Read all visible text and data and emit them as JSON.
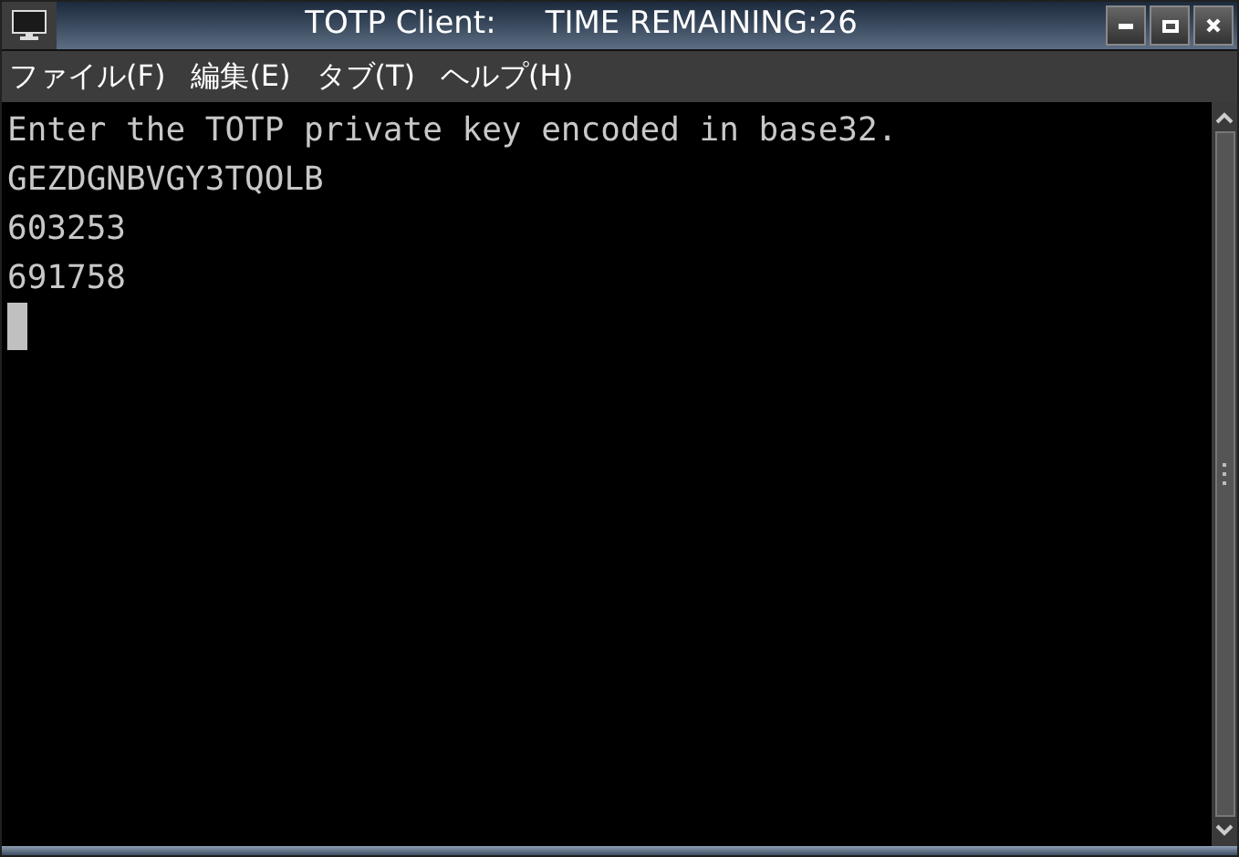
{
  "window": {
    "title": "TOTP Client:     TIME REMAINING:26"
  },
  "menu": [
    "ファイル(F)",
    "編集(E)",
    "タブ(T)",
    "ヘルプ(H)"
  ],
  "terminal": {
    "lines": [
      "Enter the TOTP private key encoded in base32.",
      "GEZDGNBVGY3TQOLB",
      "603253",
      "691758"
    ]
  }
}
